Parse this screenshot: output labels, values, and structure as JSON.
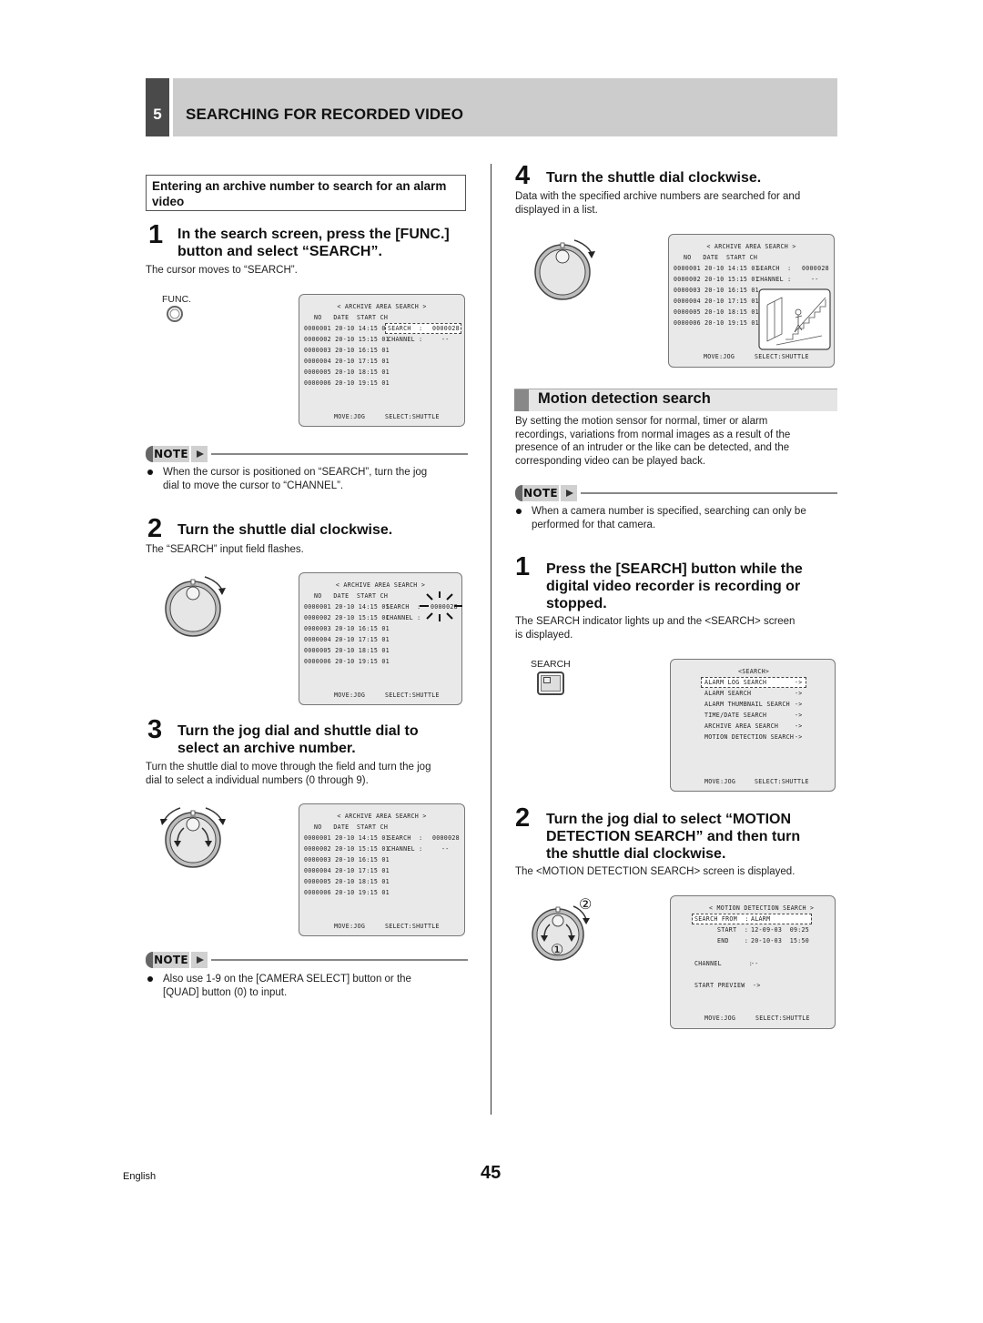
{
  "chapter": {
    "number": "5",
    "title": "SEARCHING FOR RECORDED VIDEO"
  },
  "left": {
    "subsection_box": "Entering an archive number to search for an alarm video",
    "step1": {
      "number": "1",
      "title_line1": "In the search screen, press the [FUNC.]",
      "title_line2": "button and select “SEARCH”.",
      "desc": "The cursor moves to “SEARCH”.",
      "button_label": "FUNC.",
      "button_icon": "func-button-icon"
    },
    "note1": {
      "label": "NOTE",
      "text_line1": "When the cursor is positioned on “SEARCH”, turn the jog",
      "text_line2": "dial to move the cursor to “CHANNEL”."
    },
    "step2": {
      "number": "2",
      "title": "Turn the shuttle dial clockwise.",
      "desc": "The “SEARCH” input field flashes.",
      "dial_icon": "shuttle-dial-clockwise-icon"
    },
    "step3": {
      "number": "3",
      "title_line1": "Turn the jog dial and shuttle dial to",
      "title_line2": "select an archive number.",
      "desc_line1": "Turn the shuttle dial to move through the field and turn the jog",
      "desc_line2": "dial to select a individual numbers (0 through 9).",
      "dial_icon": "jog-shuttle-dial-icon"
    },
    "note2": {
      "label": "NOTE",
      "text_line1": "Also use 1-9 on the [CAMERA SELECT] button or the",
      "text_line2": "[QUAD] button (0) to input."
    }
  },
  "archive_screen": {
    "title": "< ARCHIVE AREA SEARCH >",
    "header": "NO   DATE  START CH",
    "rows": [
      "0000001 20-10 14:15 01",
      "0000002 20-10 15:15 01",
      "0000003 20-10 16:15 01",
      "0000004 20-10 17:15 01",
      "0000005 20-10 18:15 01",
      "0000006 20-10 19:15 01"
    ],
    "search_label": "SEARCH  :",
    "search_value": "0000028",
    "channel_label": "CHANNEL :",
    "channel_value": "--",
    "footer_move": "MOVE:JOG",
    "footer_select": "SELECT:SHUTTLE"
  },
  "right": {
    "step4": {
      "number": "4",
      "title": "Turn the shuttle dial clockwise.",
      "desc_line1": "Data with the specified archive numbers are searched for and",
      "desc_line2": "displayed in a list.",
      "dial_icon": "shuttle-dial-clockwise-icon",
      "preview_icon": "staircase-intruder-preview-icon"
    },
    "section": {
      "title": "Motion detection search",
      "desc_lines": [
        "By setting the motion sensor for normal, timer or alarm",
        "recordings, variations from normal images as a result of the",
        "presence of an intruder or the like can be detected, and the",
        "corresponding video can be played back."
      ]
    },
    "note3": {
      "label": "NOTE",
      "text_line1": "When a camera number is specified, searching can only be",
      "text_line2": "performed for that camera."
    },
    "step_m1": {
      "number": "1",
      "title_lines": [
        "Press the [SEARCH] button while the",
        "digital video recorder is recording or",
        "stopped."
      ],
      "desc_line1": "The SEARCH indicator lights up and the <SEARCH> screen",
      "desc_line2": "is displayed.",
      "button_label": "SEARCH"
    },
    "search_menu": {
      "title": "<SEARCH>",
      "items": [
        {
          "label": "ALARM LOG SEARCH",
          "arrow": "->"
        },
        {
          "label": "ALARM SEARCH",
          "arrow": "->"
        },
        {
          "label": "ALARM THUMBNAIL SEARCH",
          "arrow": "->"
        },
        {
          "label": "TIME/DATE SEARCH",
          "arrow": "->"
        },
        {
          "label": "ARCHIVE AREA SEARCH",
          "arrow": "->"
        },
        {
          "label": "MOTION DETECTION SEARCH",
          "arrow": "->"
        }
      ],
      "footer_move": "MOVE:JOG",
      "footer_select": "SELECT:SHUTTLE"
    },
    "step_m2": {
      "number": "2",
      "title_lines": [
        "Turn the jog dial to select “MOTION",
        "DETECTION SEARCH” and then turn",
        "the shuttle dial clockwise."
      ],
      "desc": "The <MOTION DETECTION SEARCH> screen is displayed.",
      "dial_marker_1": "①",
      "dial_marker_2": "②"
    },
    "motion_screen": {
      "title": "< MOTION DETECTION SEARCH >",
      "search_from_label": "SEARCH FROM  :",
      "search_from_value": "ALARM",
      "start_label": "START  :",
      "start_value": "12-09-03  09:25",
      "end_label": "END    :",
      "end_value": "20-10-03  15:50",
      "channel_label": "CHANNEL       :",
      "channel_value": "--",
      "preview_label": "START PREVIEW  ->",
      "footer_move": "MOVE:JOG",
      "footer_select": "SELECT:SHUTTLE"
    }
  },
  "footer": {
    "language": "English",
    "page_number": "45"
  }
}
